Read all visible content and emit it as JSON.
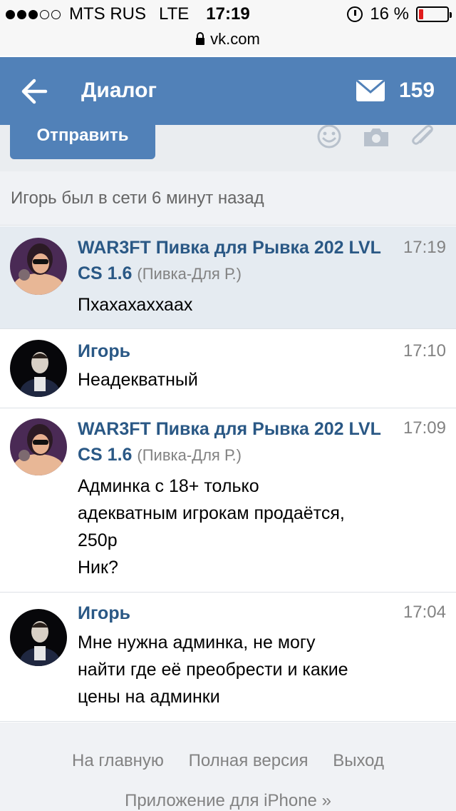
{
  "status_bar": {
    "carrier": "MTS RUS",
    "network": "LTE",
    "time": "17:19",
    "battery": "16 %",
    "battery_level": 0.16,
    "signal_bars": 3,
    "signal_total": 5
  },
  "url_bar": {
    "url": "vk.com"
  },
  "header": {
    "title": "Диалог",
    "message_count": "159",
    "icons": [
      "back-arrow-icon",
      "mail-icon"
    ]
  },
  "compose": {
    "send_label": "Отправить",
    "icons": [
      "smile-icon",
      "camera-icon",
      "paperclip-icon"
    ]
  },
  "online_status": "Игорь был в сети 6 минут назад",
  "messages": [
    {
      "author": "WAR3FT Пивка для Рывка 202 LVL CS 1.6",
      "group": "(Пивка-Для Р.)",
      "time": "17:19",
      "text": "Пхахахаххаах",
      "unread": true
    },
    {
      "author": "Игорь",
      "group": "",
      "time": "17:10",
      "text": "Неадекватный",
      "unread": false
    },
    {
      "author": "WAR3FT Пивка для Рывка 202 LVL CS 1.6",
      "group": "(Пивка-Для Р.)",
      "time": "17:09",
      "text": "Админка с 18+ только\nадекватным игрокам продаётся,\n250р\nНик?",
      "unread": false
    },
    {
      "author": "Игорь",
      "group": "",
      "time": "17:04",
      "text": "Мне нужна админка, не могу\nнайти где её преобрести и какие\nцены на админки",
      "unread": false
    }
  ],
  "footer": {
    "links": [
      "На главную",
      "Полная версия",
      "Выход"
    ],
    "app_link": "Приложение для iPhone »"
  },
  "colors": {
    "header": "#5181b8",
    "author": "#2a5885",
    "unread_bg": "#e5ebf1",
    "muted": "#828282"
  }
}
